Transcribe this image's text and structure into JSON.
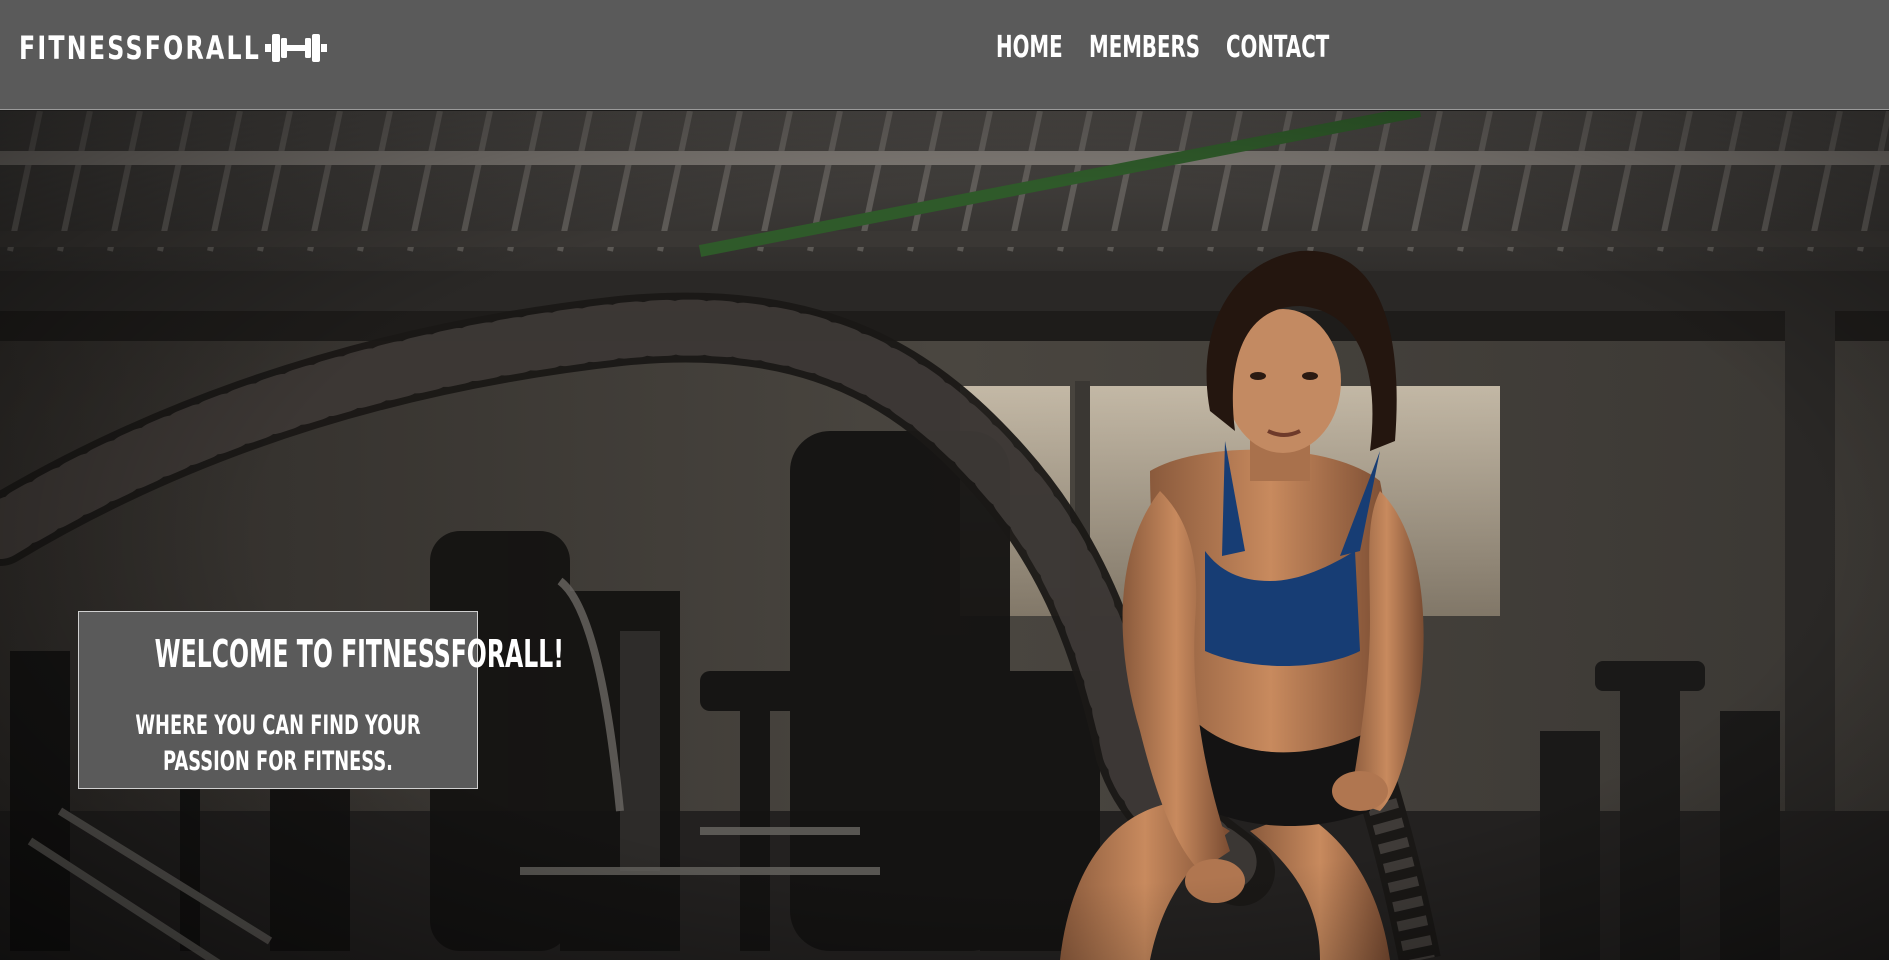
{
  "header": {
    "brand": "FITNESSFORALL",
    "brand_icon": "dumbbell-logo-icon",
    "background_color": "#5a5a5a"
  },
  "nav": {
    "items": [
      {
        "label": "HOME"
      },
      {
        "label": "MEMBERS"
      },
      {
        "label": "CONTACT"
      }
    ]
  },
  "hero": {
    "image": "woman-battle-ropes-gym-photo",
    "welcome_title": "WELCOME TO FITNESSFORALL!",
    "welcome_subtitle": "WHERE YOU CAN FIND YOUR PASSION FOR FITNESS."
  }
}
